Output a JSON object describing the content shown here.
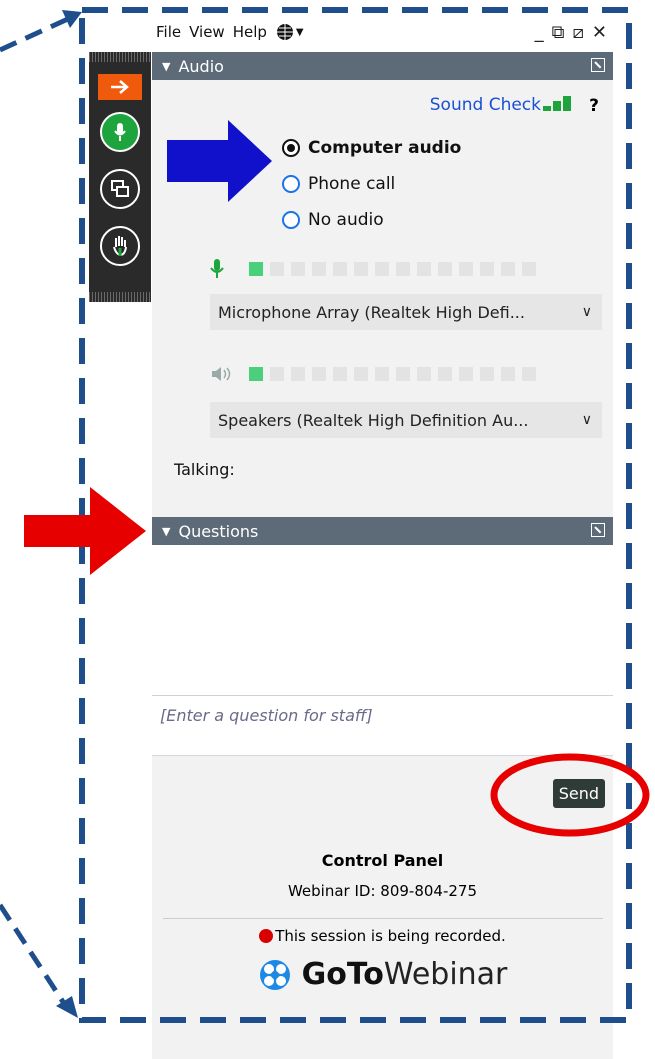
{
  "menu": {
    "file": "File",
    "view": "View",
    "help": "Help"
  },
  "audio": {
    "header": "Audio",
    "sound_check": "Sound Check",
    "help_mark": "?",
    "options": [
      {
        "label": "Computer audio",
        "selected": true
      },
      {
        "label": "Phone call",
        "selected": false
      },
      {
        "label": "No audio",
        "selected": false
      }
    ],
    "mic_level_fraction": 0.07,
    "speaker_level_fraction": 0.07,
    "microphone_device": "Microphone Array (Realtek High Defi...",
    "speaker_device": "Speakers (Realtek High Definition Au...",
    "talking_label": "Talking:"
  },
  "questions": {
    "header": "Questions",
    "placeholder": "[Enter a question for staff]",
    "send_label": "Send"
  },
  "footer": {
    "title": "Control Panel",
    "webinar_id": "Webinar ID: 809-804-275",
    "recording_notice": "This session is being recorded.",
    "logo_bold": "GoTo",
    "logo_light": "Webinar"
  },
  "annotation_colors": {
    "frame": "#1f4e8c",
    "blue_arrow": "#1111cc",
    "red": "#e60000",
    "accent": "#ef5a0c"
  }
}
